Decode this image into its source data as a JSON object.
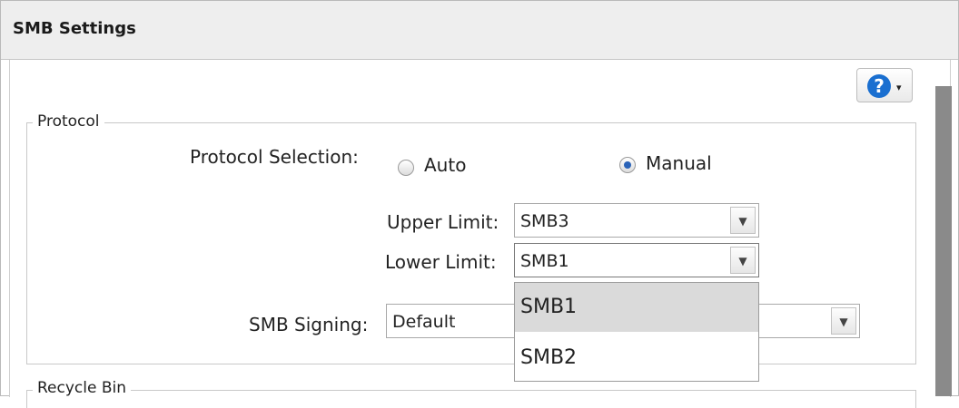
{
  "window": {
    "title": "SMB Settings"
  },
  "help": {
    "icon": "question-icon",
    "caret": "▾"
  },
  "protocol_group": {
    "legend": "Protocol",
    "selection_label": "Protocol Selection:",
    "options": [
      {
        "label": "Auto",
        "checked": false
      },
      {
        "label": "Manual",
        "checked": true
      }
    ],
    "upper_limit": {
      "label": "Upper Limit:",
      "value": "SMB3"
    },
    "lower_limit": {
      "label": "Lower Limit:",
      "value": "SMB1"
    },
    "lower_limit_options": [
      {
        "label": "SMB1",
        "selected": true
      },
      {
        "label": "SMB2",
        "selected": false
      }
    ],
    "signing": {
      "label": "SMB Signing:",
      "value": "Default"
    }
  },
  "recycle_group": {
    "legend": "Recycle Bin"
  },
  "colors": {
    "accent": "#1a6fd0",
    "titlebar": "#eeeeee",
    "highlight": "#dadada"
  }
}
